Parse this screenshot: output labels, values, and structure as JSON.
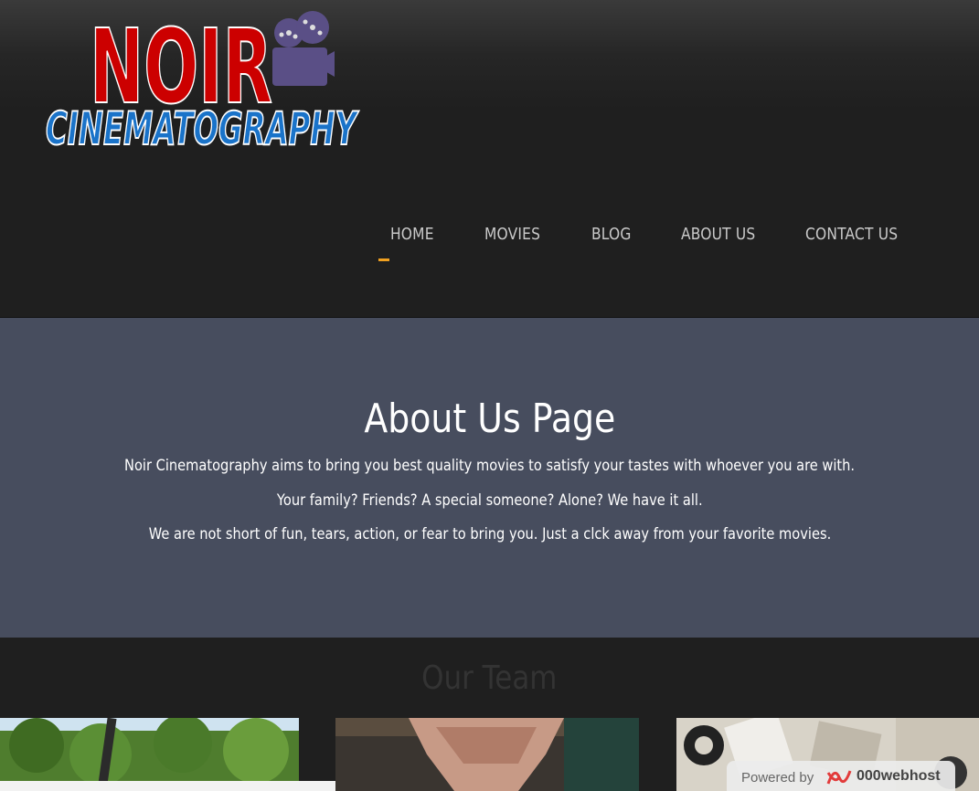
{
  "logo": {
    "top_text": "NOIR",
    "bottom_text": "CINEMATOGRAPHY",
    "icon": "film-camera-icon"
  },
  "nav": {
    "items": [
      {
        "label": "HOME",
        "active": true
      },
      {
        "label": "MOVIES",
        "active": false
      },
      {
        "label": "BLOG",
        "active": false
      },
      {
        "label": "ABOUT US",
        "active": false
      },
      {
        "label": "CONTACT US",
        "active": false
      }
    ]
  },
  "hero": {
    "title": "About Us Page",
    "lines": [
      "Noir Cinematography aims to bring you best quality movies to satisfy your tastes with whoever you are with.",
      "Your family? Friends? A special someone? Alone? We have it all.",
      "We are not short of fun, tears, action, or fear to bring you. Just a clck away from your favorite movies."
    ]
  },
  "team": {
    "title": "Our Team"
  },
  "badge": {
    "label": "Powered by",
    "brand": "000webhost",
    "icon": "000webhost-logo-icon"
  },
  "colors": {
    "header_bg": "#1f1f1f",
    "hero_bg": "#474d5e",
    "accent": "#f0a020",
    "logo_red": "#cc0000",
    "logo_blue": "#1a73c9",
    "camera": "#5a4f86"
  }
}
